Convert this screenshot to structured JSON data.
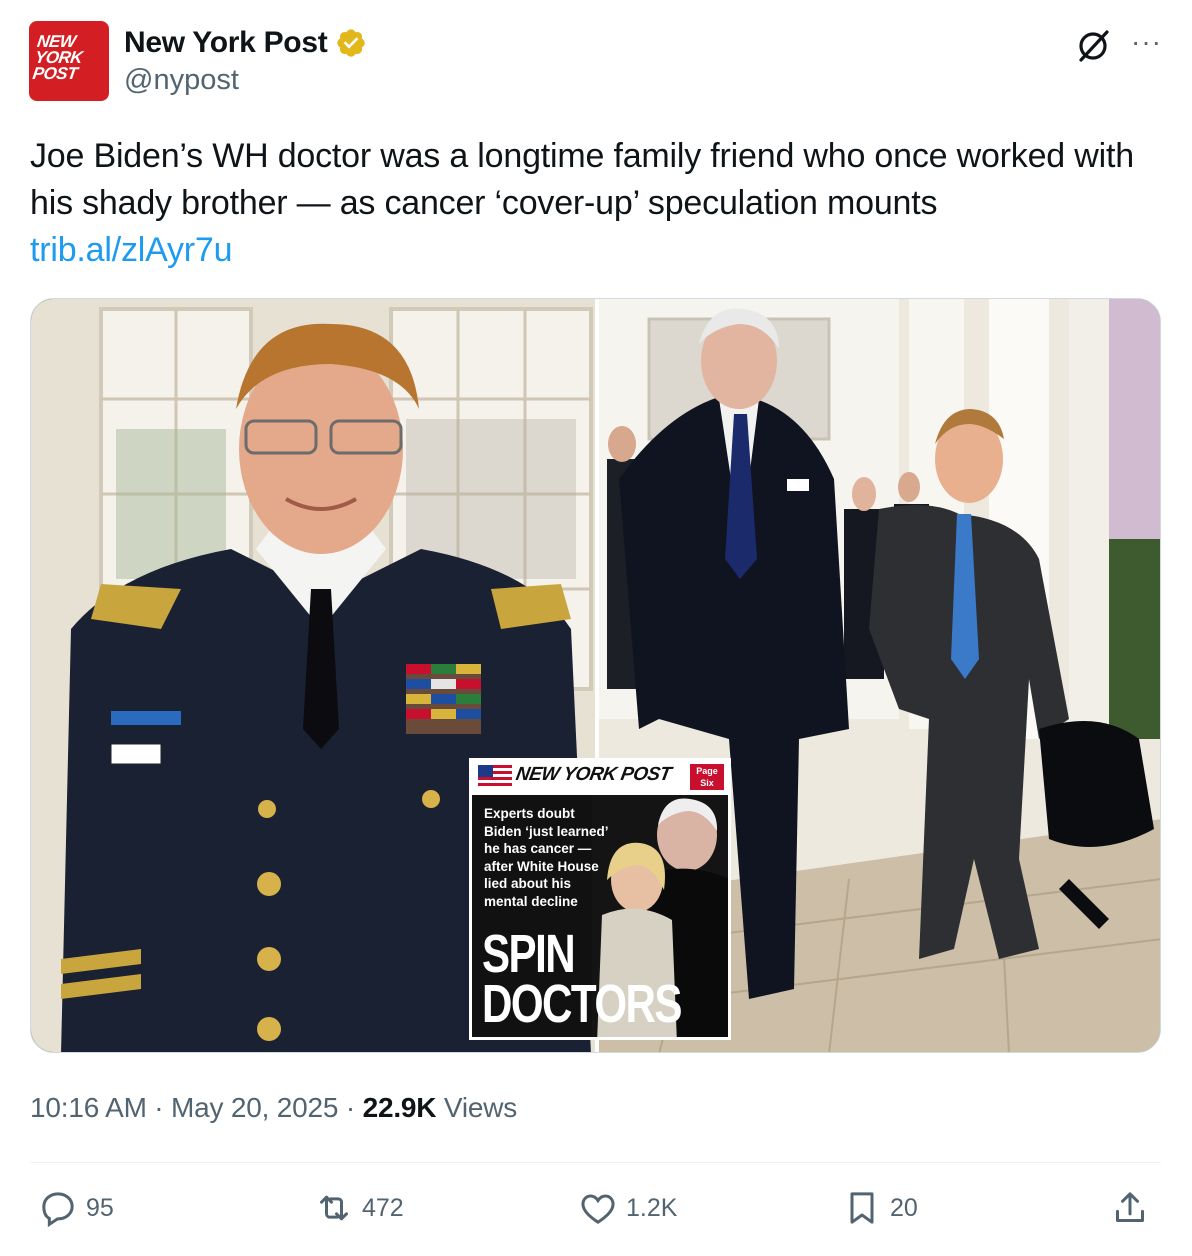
{
  "account": {
    "display_name": "New York Post",
    "handle": "@nypost",
    "avatar_text": "NEW YORK POST",
    "verified_badge": "gold-verified-icon"
  },
  "tweet": {
    "text": "Joe Biden’s WH doctor was a longtime family friend who once worked with his shady brother — as cancer ‘cover-up’ speculation mounts",
    "link": "trib.al/zlAyr7u"
  },
  "media": {
    "cover": {
      "masthead": "NEW YORK POST",
      "page_six": "Page Six",
      "teaser": "Experts doubt Biden ‘just learned’ he has cancer — after White House lied about his mental decline",
      "headline_line1": "SPIN",
      "headline_line2": "DOCTORS"
    }
  },
  "meta": {
    "time": "10:16 AM",
    "date": "May 20, 2025",
    "views_count": "22.9K",
    "views_label": "Views"
  },
  "actions": {
    "replies": "95",
    "reposts": "472",
    "likes": "1.2K",
    "bookmarks": "20"
  },
  "colors": {
    "link": "#1d9bf0",
    "secondary_text": "#536471",
    "avatar_red": "#d31e24",
    "verified_gold": "#e2b719"
  }
}
